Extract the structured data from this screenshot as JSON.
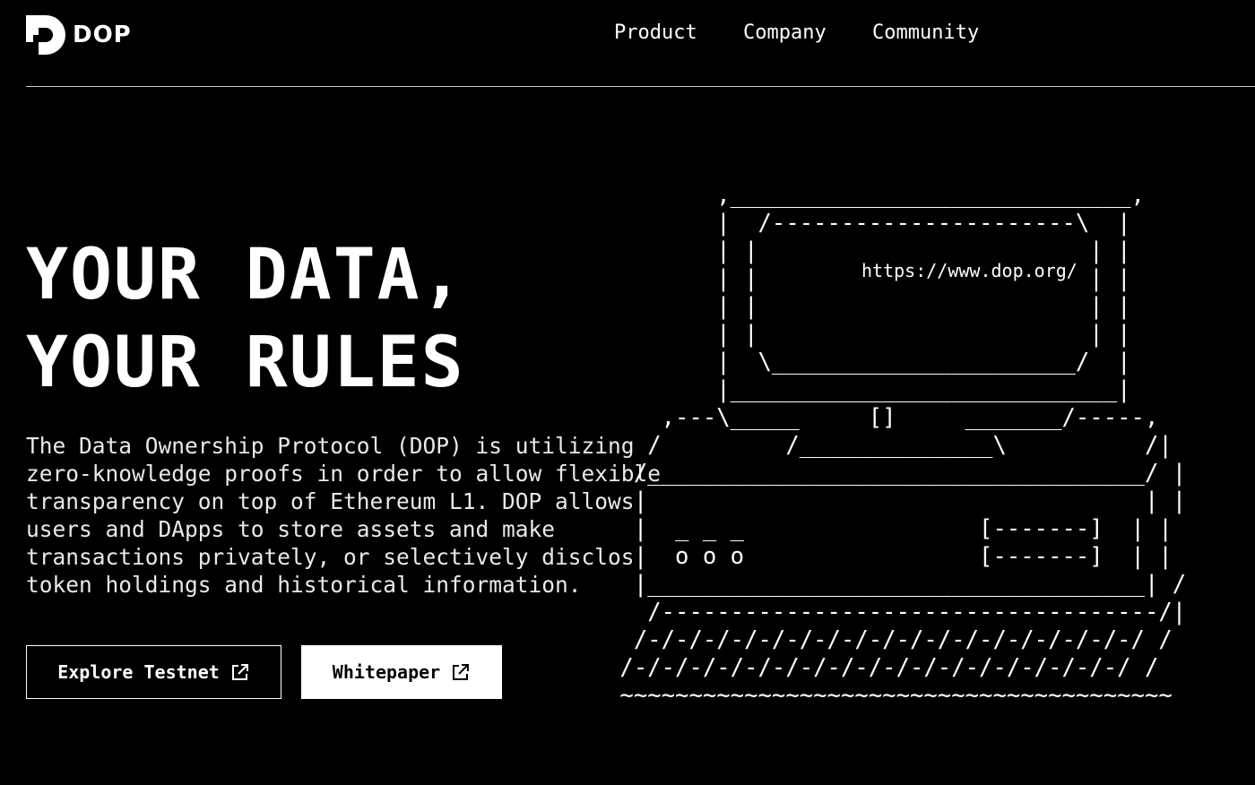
{
  "header": {
    "logo_text": "DOP",
    "nav": [
      "Product",
      "Company",
      "Community"
    ]
  },
  "hero": {
    "title_line1": "YOUR DATA,",
    "title_line2": "YOUR RULES",
    "description": "The Data Ownership Protocol (DOP) is utilizing\nzero-knowledge proofs in order to allow flexible\ntransparency on top of Ethereum L1. DOP allows\nusers and DApps to store assets and make\ntransactions privately, or selectively disclos\ntoken holdings and historical information.",
    "buttons": {
      "explore_label": "Explore Testnet",
      "whitepaper_label": "Whitepaper"
    }
  },
  "illustration": {
    "screen_url": "https://www.dop.org/",
    "ascii_art": "        ,_____________________________,\n        |  /----------------------\\  |\n        | |                        | |\n        | |                        | |\n        | |                        | |\n        | |                        | |\n        |  \\______________________/  |\n        |____________________________|\n    ,---\\_____     []     _______/-----,\n   /         /______________\\          /|\n  /____________________________________/ |\n  |                                    | |\n  |  _ _ _                 [-------]  | |\n  |  o o o                 [-------]  | |\n  |____________________________________| /\n   /------------------------------------/|\n  /-/-/-/-/-/-/-/-/-/-/-/-/-/-/-/-/-/-/ /\n /-/-/-/-/-/-/-/-/-/-/-/-/-/-/-/-/-/-/ /\n ~~~~~~~~~~~~~~~~~~~~~~~~~~~~~~~~~~~~~~~~"
  },
  "icons": {
    "logo": "dop-logo-icon",
    "external_link": "external-link-icon"
  }
}
